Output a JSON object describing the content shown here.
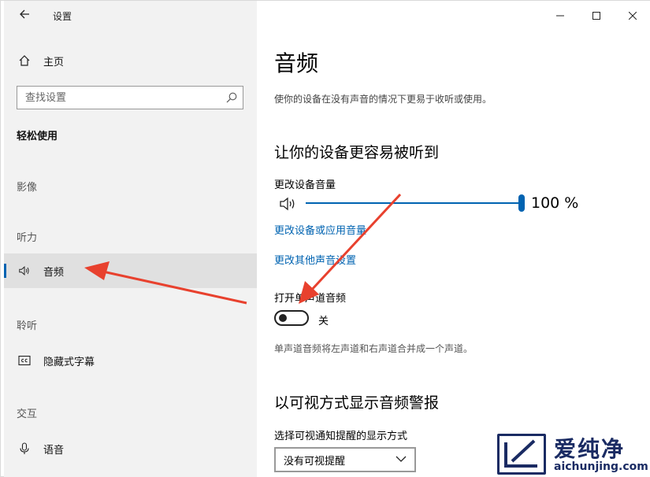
{
  "window": {
    "app_title": "设置"
  },
  "sidebar": {
    "home_label": "主页",
    "search": {
      "placeholder": "查找设置"
    },
    "section_title": "轻松使用",
    "groups": {
      "vision": "影像",
      "hearing": "听力",
      "listening": "聆听",
      "interaction": "交互"
    },
    "items": {
      "audio": "音频",
      "captions": "隐藏式字幕",
      "speech": "语音"
    },
    "icons": {
      "back": "back-arrow-icon",
      "home": "home-icon",
      "search": "search-icon",
      "audio": "speaker-icon",
      "captions": "cc-icon",
      "speech": "microphone-icon"
    }
  },
  "main": {
    "title": "音频",
    "description": "使你的设备在没有声音的情况下更易于收听或使用。",
    "section1_heading": "让你的设备更容易被听到",
    "volume_label": "更改设备音量",
    "volume_value": "100 %",
    "volume_percent": 100,
    "link_app_volume": "更改设备或应用音量",
    "link_other_sound": "更改其他声音设置",
    "mono_label": "打开单声道音频",
    "mono_state": "关",
    "mono_on": false,
    "mono_description": "单声道音频将左声道和右声道合并成一个声道。",
    "section2_heading": "以可视方式显示音频警报",
    "visual_alert_label": "选择可视通知提醒的显示方式",
    "visual_alert_value": "没有可视提醒"
  },
  "watermark": {
    "brand": "爱纯净",
    "url": "aichunjing.com"
  },
  "colors": {
    "accent": "#0063b1",
    "sidebar_bg": "#f2f2f2",
    "active_bg": "#e0e0e0",
    "annotation_red": "#e8412e",
    "watermark_blue": "#1a2b63"
  }
}
